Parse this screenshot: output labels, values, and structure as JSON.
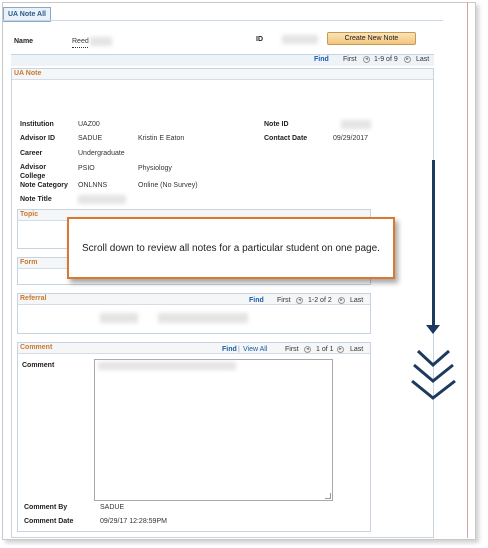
{
  "tab": {
    "label": "UA Note All"
  },
  "header": {
    "name_label": "Name",
    "name_value": "Reed",
    "id_label": "ID",
    "create_button": "Create New Note"
  },
  "nav_main": {
    "find": "Find",
    "first": "First",
    "range": "1-9 of 9",
    "last": "Last"
  },
  "note": {
    "section_title": "UA Note",
    "institution_label": "Institution",
    "institution_value": "UAZ00",
    "advisor_id_label": "Advisor ID",
    "advisor_id_value": "SADUE",
    "advisor_name": "Kristin E Eaton",
    "career_label": "Career",
    "career_value": "Undergraduate",
    "advisor_college_label_1": "Advisor",
    "advisor_college_label_2": "College",
    "advisor_college_value": "PSIO",
    "advisor_college_desc": "Physiology",
    "note_category_label": "Note Category",
    "note_category_value": "ONLNNS",
    "note_category_desc": "Online (No Survey)",
    "note_title_label": "Note Title",
    "note_id_label": "Note ID",
    "contact_date_label": "Contact Date",
    "contact_date_value": "09/29/2017"
  },
  "topic": {
    "title": "Topic"
  },
  "form": {
    "title": "Form"
  },
  "referral": {
    "title": "Referral",
    "find": "Find",
    "first": "First",
    "range": "1-2 of 2",
    "last": "Last"
  },
  "comment": {
    "title": "Comment",
    "find": "Find",
    "view_all": "View All",
    "first": "First",
    "range": "1 of 1",
    "last": "Last",
    "comment_label": "Comment",
    "comment_by_label": "Comment By",
    "comment_by_value": "SADUE",
    "comment_date_label": "Comment Date",
    "comment_date_value": "09/29/17 12:28:59PM"
  },
  "callout": {
    "text": "Scroll down to review all notes for a particular student on one page."
  },
  "icons": {
    "scroll_arrow": "down-arrow-icon",
    "scroll_chevrons": "double-chevron-down-icon"
  },
  "colors": {
    "accent": "#c9792f",
    "link": "#1a5ca8",
    "callout_border": "#d9782f",
    "arrow": "#1c3a5e"
  }
}
